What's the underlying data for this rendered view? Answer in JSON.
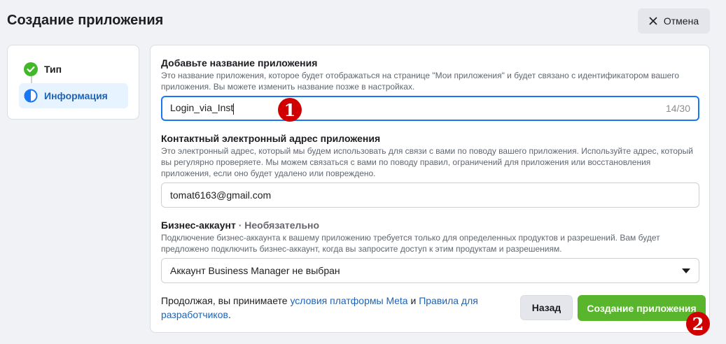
{
  "header": {
    "title": "Создание приложения",
    "cancel_label": "Отмена"
  },
  "steps": [
    {
      "label": "Тип",
      "status": "complete"
    },
    {
      "label": "Информация",
      "status": "in-progress"
    }
  ],
  "form": {
    "app_name": {
      "title": "Добавьте название приложения",
      "description": "Это название приложения, которое будет отображаться на странице \"Мои приложения\" и будет связано с идентификатором вашего приложения. Вы можете изменить название позже в настройках.",
      "value": "Login_via_Inst",
      "counter": "14/30"
    },
    "contact_email": {
      "title": "Контактный электронный адрес приложения",
      "description": "Это электронный адрес, который мы будем использовать для связи с вами по поводу вашего приложения. Используйте адрес, который вы регулярно проверяете. Мы можем связаться с вами по поводу правил, ограничений для приложения или восстановления приложения, если оно будет удалено или повреждено.",
      "value": "tomat6163@gmail.com"
    },
    "business_account": {
      "title": "Бизнес-аккаунт",
      "optional": "· Необязательно",
      "description": "Подключение бизнес-аккаунта к вашему приложению требуется только для определенных продуктов и разрешений. Вам будет предложено подключить бизнес-аккаунт, когда вы запросите доступ к этим продуктам и разрешениям.",
      "selected": "Аккаунт Business Manager не выбран"
    }
  },
  "footer": {
    "terms_prefix": "Продолжая, вы принимаете ",
    "terms_link_1": "условия платформы Meta",
    "terms_and": " и ",
    "terms_link_2": "Правила для разработчиков",
    "terms_suffix": ".",
    "back_label": "Назад",
    "create_label": "Создание приложения"
  },
  "annotations": {
    "marker_1": "❶",
    "marker_2": "❷"
  },
  "colors": {
    "accent": "#1877f2",
    "primary_button": "#59b52b",
    "link": "#1d63b7",
    "marker": "#d10000"
  }
}
